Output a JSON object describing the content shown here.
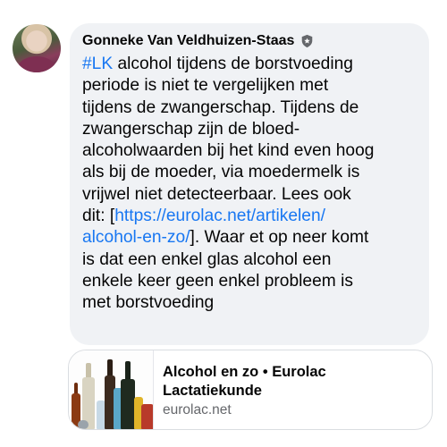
{
  "post": {
    "author": "Gonneke Van Veldhuizen-Staas",
    "author_badge_icon": "shield-icon",
    "avatar_icon": "profile-photo",
    "message_lines": [
      {
        "text": "#LK",
        "rest": " alcohol tijdens de borstvoeding"
      },
      "periode is niet te vergelijken met",
      "tijdens de zwangerschap. Tijdens de",
      "zwangerschap zijn de bloed-",
      "alcoholwaarden bij het kind even hoog",
      "als bij de moeder, via moedermelk is",
      "vrijwel niet detecteerbaar. Lees ook",
      {
        "pre": "dit: [",
        "link": "https://eurolac.net/artikelen/"
      },
      {
        "link": "alcohol-en-zo/",
        "post": "]. Waar et op neer komt"
      },
      "is dat een enkel glas alcohol een",
      "enkele keer geen enkel probleem is",
      "met borstvoeding"
    ]
  },
  "link_preview": {
    "title": "Alcohol en zo • Eurolac Lactatiekunde",
    "domain": "eurolac.net",
    "thumbnail_icon": "bottles-image"
  },
  "colors": {
    "bubble": "#f0f2f5",
    "link": "#1877f2",
    "secondary_text": "#65676b"
  }
}
